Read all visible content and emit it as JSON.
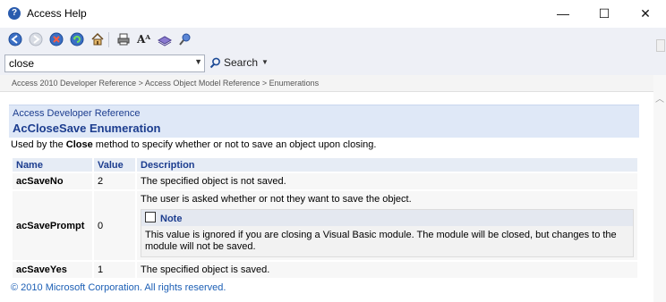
{
  "window": {
    "title": "Access Help",
    "minimize_glyph": "—",
    "maximize_glyph": "☐",
    "close_glyph": "✕"
  },
  "toolbar": {
    "buttons": [
      "back-icon",
      "forward-icon",
      "stop-icon",
      "refresh-icon",
      "home-icon",
      "print-icon",
      "text-size-icon",
      "table-of-contents-icon",
      "keep-on-top-icon"
    ],
    "text_size_glyph": "Aᴬ"
  },
  "search": {
    "value": "close",
    "button_label": "Search"
  },
  "breadcrumb": "Access 2010 Developer Reference > Access Object Model Reference > Enumerations",
  "content": {
    "product": "Access Developer Reference",
    "title": "AcCloseSave Enumeration",
    "intro_prefix": "Used by the ",
    "intro_method": "Close",
    "intro_suffix": " method to specify whether or not to save an object upon closing."
  },
  "table": {
    "headers": [
      "Name",
      "Value",
      "Description"
    ],
    "rows": [
      {
        "name": "acSaveNo",
        "value": "2",
        "description": "The specified object is not saved."
      },
      {
        "name": "acSavePrompt",
        "value": "0",
        "description": "The user is asked whether or not they want to save the object.",
        "note_title": "Note",
        "note_text": "This value is ignored if you are closing a Visual Basic module. The module will be closed, but changes to the module will not be saved."
      },
      {
        "name": "acSaveYes",
        "value": "1",
        "description": "The specified object is saved."
      }
    ]
  },
  "footer": {
    "copyright": "© 2010 Microsoft Corporation. All rights reserved."
  }
}
